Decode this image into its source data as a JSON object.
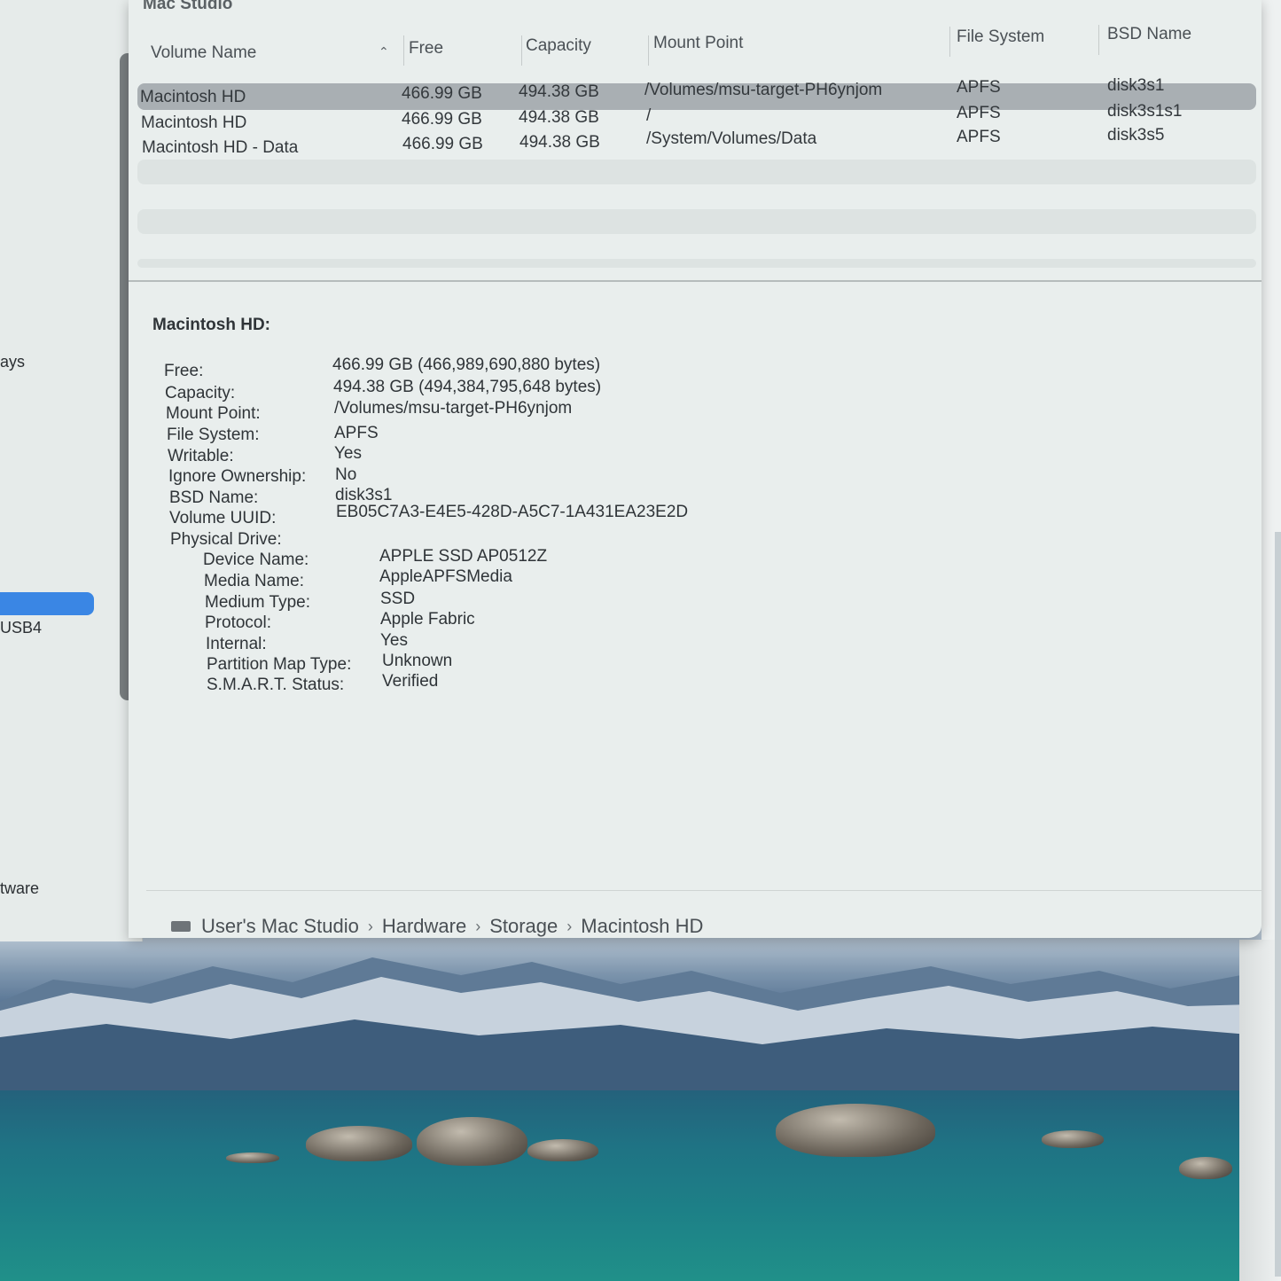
{
  "window": {
    "title": "Mac Studio"
  },
  "sidebar": {
    "items": [
      {
        "label": "ays"
      },
      {
        "label": "USB4"
      },
      {
        "label": "tware"
      }
    ]
  },
  "table": {
    "columns": [
      "Volume Name",
      "Free",
      "Capacity",
      "Mount Point",
      "File System",
      "BSD Name"
    ],
    "rows": [
      {
        "name": "Macintosh HD",
        "free": "466.99 GB",
        "capacity": "494.38 GB",
        "mount": "/Volumes/msu-target-PH6ynjom",
        "fs": "APFS",
        "bsd": "disk3s1"
      },
      {
        "name": "Macintosh HD",
        "free": "466.99 GB",
        "capacity": "494.38 GB",
        "mount": "/",
        "fs": "APFS",
        "bsd": "disk3s1s1"
      },
      {
        "name": "Macintosh HD - Data",
        "free": "466.99 GB",
        "capacity": "494.38 GB",
        "mount": "/System/Volumes/Data",
        "fs": "APFS",
        "bsd": "disk3s5"
      }
    ]
  },
  "detail": {
    "title": "Macintosh HD:",
    "fields": [
      {
        "key": "Free:",
        "value": "466.99 GB (466,989,690,880 bytes)"
      },
      {
        "key": "Capacity:",
        "value": "494.38 GB (494,384,795,648 bytes)"
      },
      {
        "key": "Mount Point:",
        "value": "/Volumes/msu-target-PH6ynjom"
      },
      {
        "key": "File System:",
        "value": "APFS"
      },
      {
        "key": "Writable:",
        "value": "Yes"
      },
      {
        "key": "Ignore Ownership:",
        "value": "No"
      },
      {
        "key": "BSD Name:",
        "value": "disk3s1"
      },
      {
        "key": "Volume UUID:",
        "value": "EB05C7A3-E4E5-428D-A5C7-1A431EA23E2D"
      }
    ],
    "physical_drive_label": "Physical Drive:",
    "physical_drive": [
      {
        "key": "Device Name:",
        "value": "APPLE SSD AP0512Z"
      },
      {
        "key": "Media Name:",
        "value": "AppleAPFSMedia"
      },
      {
        "key": "Medium Type:",
        "value": "SSD"
      },
      {
        "key": "Protocol:",
        "value": "Apple Fabric"
      },
      {
        "key": "Internal:",
        "value": "Yes"
      },
      {
        "key": "Partition Map Type:",
        "value": "Unknown"
      },
      {
        "key": "S.M.A.R.T. Status:",
        "value": "Verified"
      }
    ]
  },
  "breadcrumb": [
    "User's Mac Studio",
    "Hardware",
    "Storage",
    "Macintosh HD"
  ],
  "colors": {
    "selection": "#3a86e4",
    "row_selected": "#a9afb3"
  }
}
